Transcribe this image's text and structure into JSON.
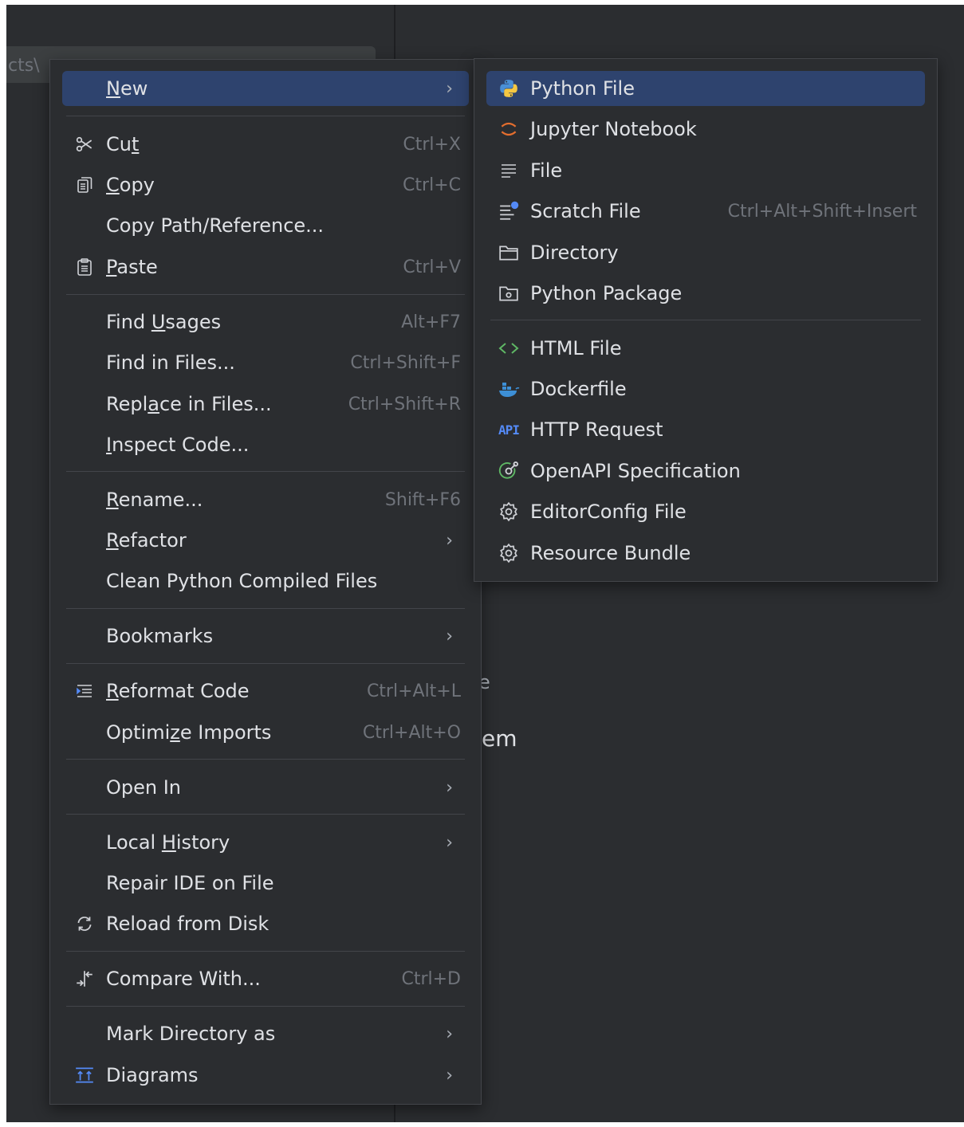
{
  "background": {
    "path_fragment": "cts\\",
    "text_partial_1": "e",
    "text_partial_2": "em"
  },
  "main_menu": {
    "items": [
      {
        "id": "new",
        "label": "New",
        "mnemonic": "N",
        "arrow": "›",
        "highlighted": true
      },
      {
        "id": "cut",
        "label": "Cut",
        "mnemonic": "t",
        "shortcut": "Ctrl+X",
        "icon": "scissors-icon"
      },
      {
        "id": "copy",
        "label": "Copy",
        "mnemonic": "C",
        "shortcut": "Ctrl+C",
        "icon": "copy-icon"
      },
      {
        "id": "copy-path",
        "label": "Copy Path/Reference..."
      },
      {
        "id": "paste",
        "label": "Paste",
        "mnemonic": "P",
        "shortcut": "Ctrl+V",
        "icon": "paste-icon"
      },
      {
        "id": "find-usages",
        "label": "Find Usages",
        "shortcut": "Alt+F7"
      },
      {
        "id": "find-in-files",
        "label": "Find in Files...",
        "shortcut": "Ctrl+Shift+F"
      },
      {
        "id": "replace-in-files",
        "label": "Replace in Files...",
        "shortcut": "Ctrl+Shift+R"
      },
      {
        "id": "inspect-code",
        "label": "Inspect Code..."
      },
      {
        "id": "rename",
        "label": "Rename...",
        "shortcut": "Shift+F6"
      },
      {
        "id": "refactor",
        "label": "Refactor",
        "arrow": "›"
      },
      {
        "id": "clean-python",
        "label": "Clean Python Compiled Files"
      },
      {
        "id": "bookmarks",
        "label": "Bookmarks",
        "arrow": "›"
      },
      {
        "id": "reformat-code",
        "label": "Reformat Code",
        "shortcut": "Ctrl+Alt+L",
        "icon": "reformat-icon"
      },
      {
        "id": "optimize-imports",
        "label": "Optimize Imports",
        "shortcut": "Ctrl+Alt+O"
      },
      {
        "id": "open-in",
        "label": "Open In",
        "arrow": "›"
      },
      {
        "id": "local-history",
        "label": "Local History",
        "arrow": "›"
      },
      {
        "id": "repair-ide",
        "label": "Repair IDE on File"
      },
      {
        "id": "reload-from-disk",
        "label": "Reload from Disk",
        "icon": "reload-icon"
      },
      {
        "id": "compare-with",
        "label": "Compare With...",
        "shortcut": "Ctrl+D",
        "icon": "compare-icon"
      },
      {
        "id": "mark-directory",
        "label": "Mark Directory as",
        "arrow": "›"
      },
      {
        "id": "diagrams",
        "label": "Diagrams",
        "arrow": "›",
        "icon": "diagrams-icon"
      }
    ]
  },
  "sub_menu": {
    "items": [
      {
        "id": "python-file",
        "label": "Python File",
        "icon": "python-icon",
        "highlighted": true
      },
      {
        "id": "jupyter-notebook",
        "label": "Jupyter Notebook",
        "icon": "jupyter-icon"
      },
      {
        "id": "file",
        "label": "File",
        "icon": "file-lines-icon"
      },
      {
        "id": "scratch-file",
        "label": "Scratch File",
        "shortcut": "Ctrl+Alt+Shift+Insert",
        "icon": "scratch-file-icon"
      },
      {
        "id": "directory",
        "label": "Directory",
        "icon": "folder-icon"
      },
      {
        "id": "python-package",
        "label": "Python Package",
        "icon": "package-icon"
      },
      {
        "id": "html-file",
        "label": "HTML File",
        "icon": "html-icon"
      },
      {
        "id": "dockerfile",
        "label": "Dockerfile",
        "icon": "docker-icon"
      },
      {
        "id": "http-request",
        "label": "HTTP Request",
        "icon": "api-icon",
        "icon_text": "API"
      },
      {
        "id": "openapi-spec",
        "label": "OpenAPI Specification",
        "icon": "openapi-icon"
      },
      {
        "id": "editorconfig",
        "label": "EditorConfig File",
        "icon": "gear-icon"
      },
      {
        "id": "resource-bundle",
        "label": "Resource Bundle",
        "icon": "gear-icon"
      }
    ]
  },
  "colors": {
    "highlight": "#2e436e",
    "menu_bg": "#2b2d30",
    "text": "#dfe1e5",
    "shortcut": "#6f737a",
    "python_blue": "#4a8fd6",
    "python_yellow": "#f5c842",
    "jupyter_orange": "#e46e2e",
    "html_green": "#5fb865",
    "docker_blue": "#3d8fd6",
    "api_blue": "#548af7"
  }
}
